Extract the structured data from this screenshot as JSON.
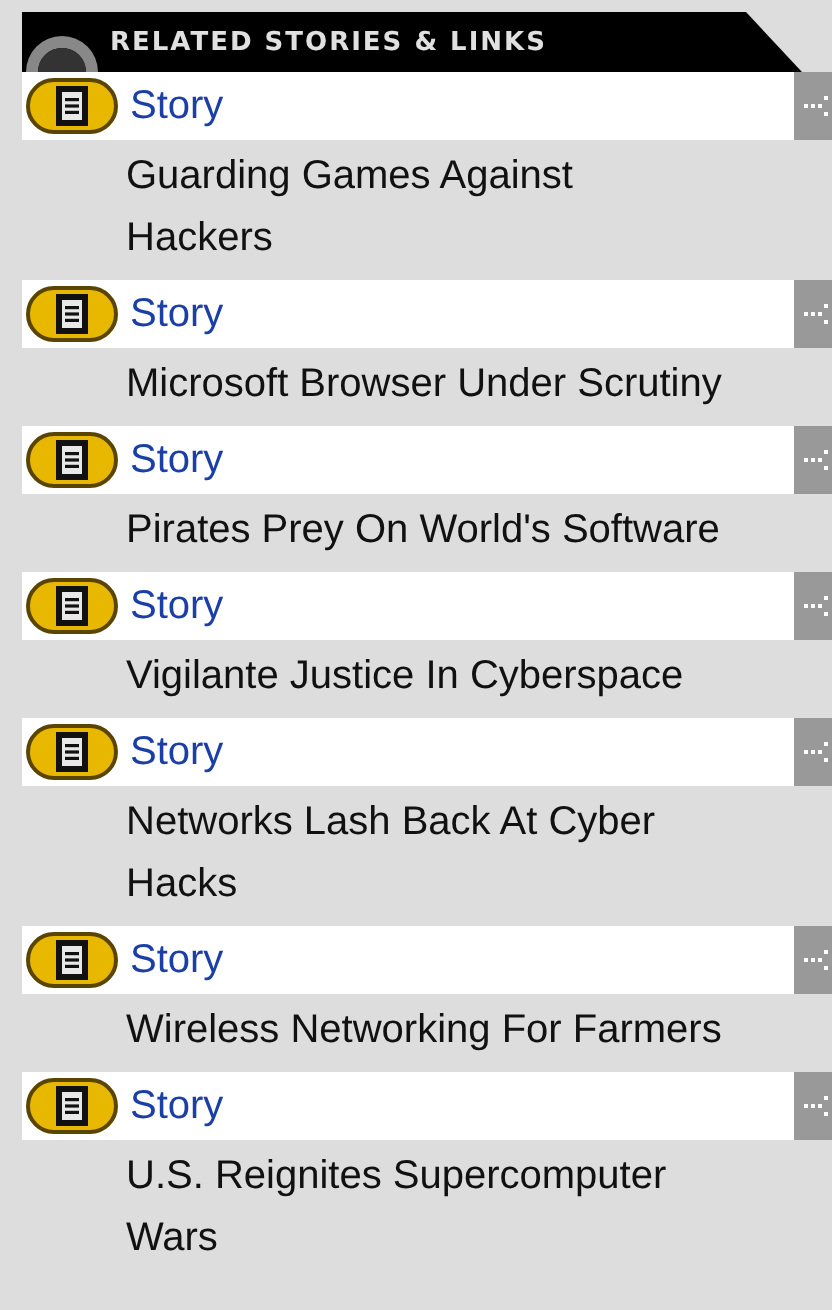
{
  "header": {
    "title": "RELATED STORIES & LINKS"
  },
  "items": [
    {
      "type": "Story",
      "title_lines": [
        "Guarding Games Against",
        "Hackers"
      ]
    },
    {
      "type": "Story",
      "title_lines": [
        "Microsoft Browser Under Scrutiny"
      ]
    },
    {
      "type": "Story",
      "title_lines": [
        "Pirates Prey On World's Software"
      ]
    },
    {
      "type": "Story",
      "title_lines": [
        "Vigilante Justice In Cyberspace"
      ]
    },
    {
      "type": "Story",
      "title_lines": [
        "Networks Lash Back At Cyber",
        "Hacks"
      ]
    },
    {
      "type": "Story",
      "title_lines": [
        "Wireless Networking For Farmers"
      ]
    },
    {
      "type": "Story",
      "title_lines": [
        "U.S. Reignites Supercomputer",
        "Wars"
      ]
    }
  ]
}
